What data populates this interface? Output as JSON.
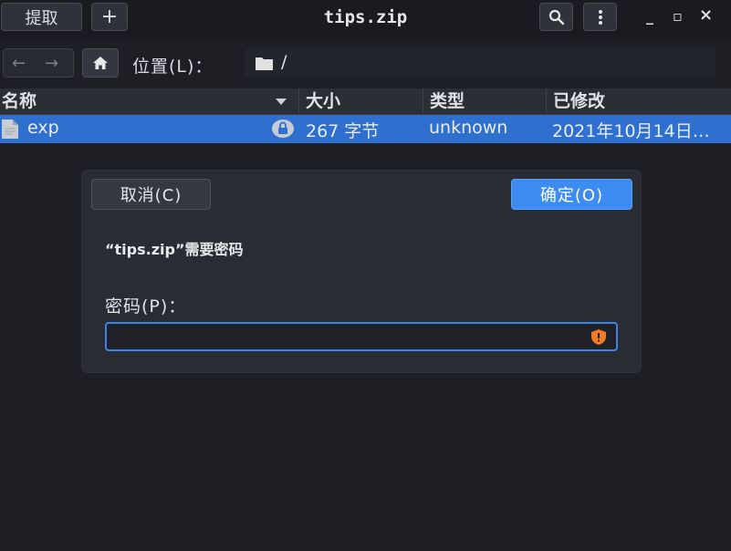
{
  "window": {
    "title": "tips.zip",
    "extract_label": "提取",
    "add_label": "+",
    "minimize_glyph": "_",
    "maximize_glyph": "▫",
    "close_glyph": "×"
  },
  "location": {
    "label": "位置(L)：",
    "path": "/"
  },
  "columns": {
    "name": "名称",
    "size": "大小",
    "type": "类型",
    "modified": "已修改"
  },
  "files": [
    {
      "name": "exp",
      "size": "267 字节",
      "type": "unknown",
      "modified": "2021年10月14日…",
      "encrypted": true
    }
  ],
  "dialog": {
    "cancel_label": "取消(C)",
    "ok_label": "确定(O)",
    "message": "“tips.zip”需要密码",
    "password_label": "密码(P)：",
    "password_value": ""
  },
  "colors": {
    "accent": "#3c8cf2",
    "selection": "#2f6fcf",
    "warning_icon": "#f07b22"
  }
}
